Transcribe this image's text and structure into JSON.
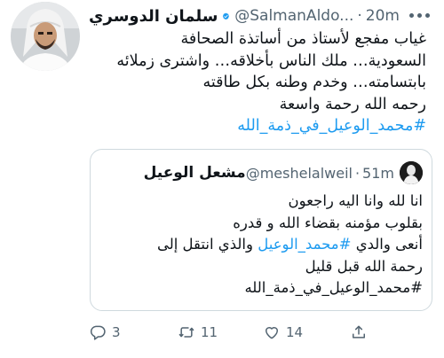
{
  "tweet": {
    "author_name": "سلمان الدوسري",
    "handle": "@SalmanAldo...",
    "separator": "·",
    "time": "20m",
    "body_lines": [
      "غياب مفجع لأستاذ من أساتذة الصحافة",
      "السعودية… ملك الناس بأخلاقه… واشترى زملائه",
      "بابتسامته… وخدم وطنه بكل طاقته",
      "رحمه الله رحمة واسعة"
    ],
    "hashtag": "#محمد_الوعيل_في_ذمة_الله"
  },
  "quote": {
    "author_name": "مشعل الوعيل",
    "handle": "@meshelalweil",
    "separator": "·",
    "time": "51m",
    "body_lines": [
      "انا لله وانا اليه راجعون",
      "بقلوب مؤمنه بقضاء الله و قدره"
    ],
    "line3_prefix": "أنعى والدي ",
    "line3_hashtag": "#محمد_الوعيل",
    "line3_suffix": " والذي انتقل إلى",
    "line4": "رحمة الله قبل قليل",
    "hashtag": "#محمد_الوعيل_في_ذمة_الله"
  },
  "actions": {
    "reply_count": "3",
    "retweet_count": "11",
    "like_count": "14"
  },
  "icons": {
    "verified": "verified-badge-icon",
    "more": "more-options-icon",
    "reply": "reply-icon",
    "retweet": "retweet-icon",
    "like": "like-icon",
    "share": "share-icon"
  },
  "colors": {
    "link": "#1d9bf0",
    "text": "#0f1419",
    "muted": "#536471",
    "border": "#cfd9de"
  }
}
